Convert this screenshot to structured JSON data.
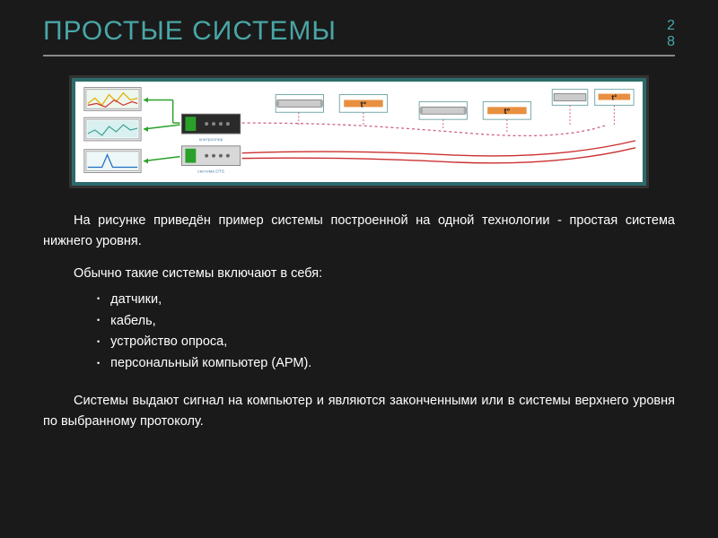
{
  "header": {
    "title": "ПРОСТЫЕ СИСТЕМЫ",
    "page_number": "28"
  },
  "diagram": {
    "alt": "Схема простой системы нижнего уровня: три монитора с графиками, два устройства опроса, датчики t° соединённые кабелем",
    "labels": {
      "sensor_symbol": "t°"
    }
  },
  "content": {
    "intro": "На рисунке приведён пример системы построенной на одной технологии - простая система нижнего уровня.",
    "list_intro": "Обычно такие системы  включают в себя:",
    "bullets": [
      "датчики,",
      "кабель,",
      "устройство опроса,",
      "персональный компьютер (АРМ)."
    ],
    "outro": "Системы выдают сигнал на компьютер и являются законченными или в системы верхнего уровня по выбранному протоколу."
  }
}
